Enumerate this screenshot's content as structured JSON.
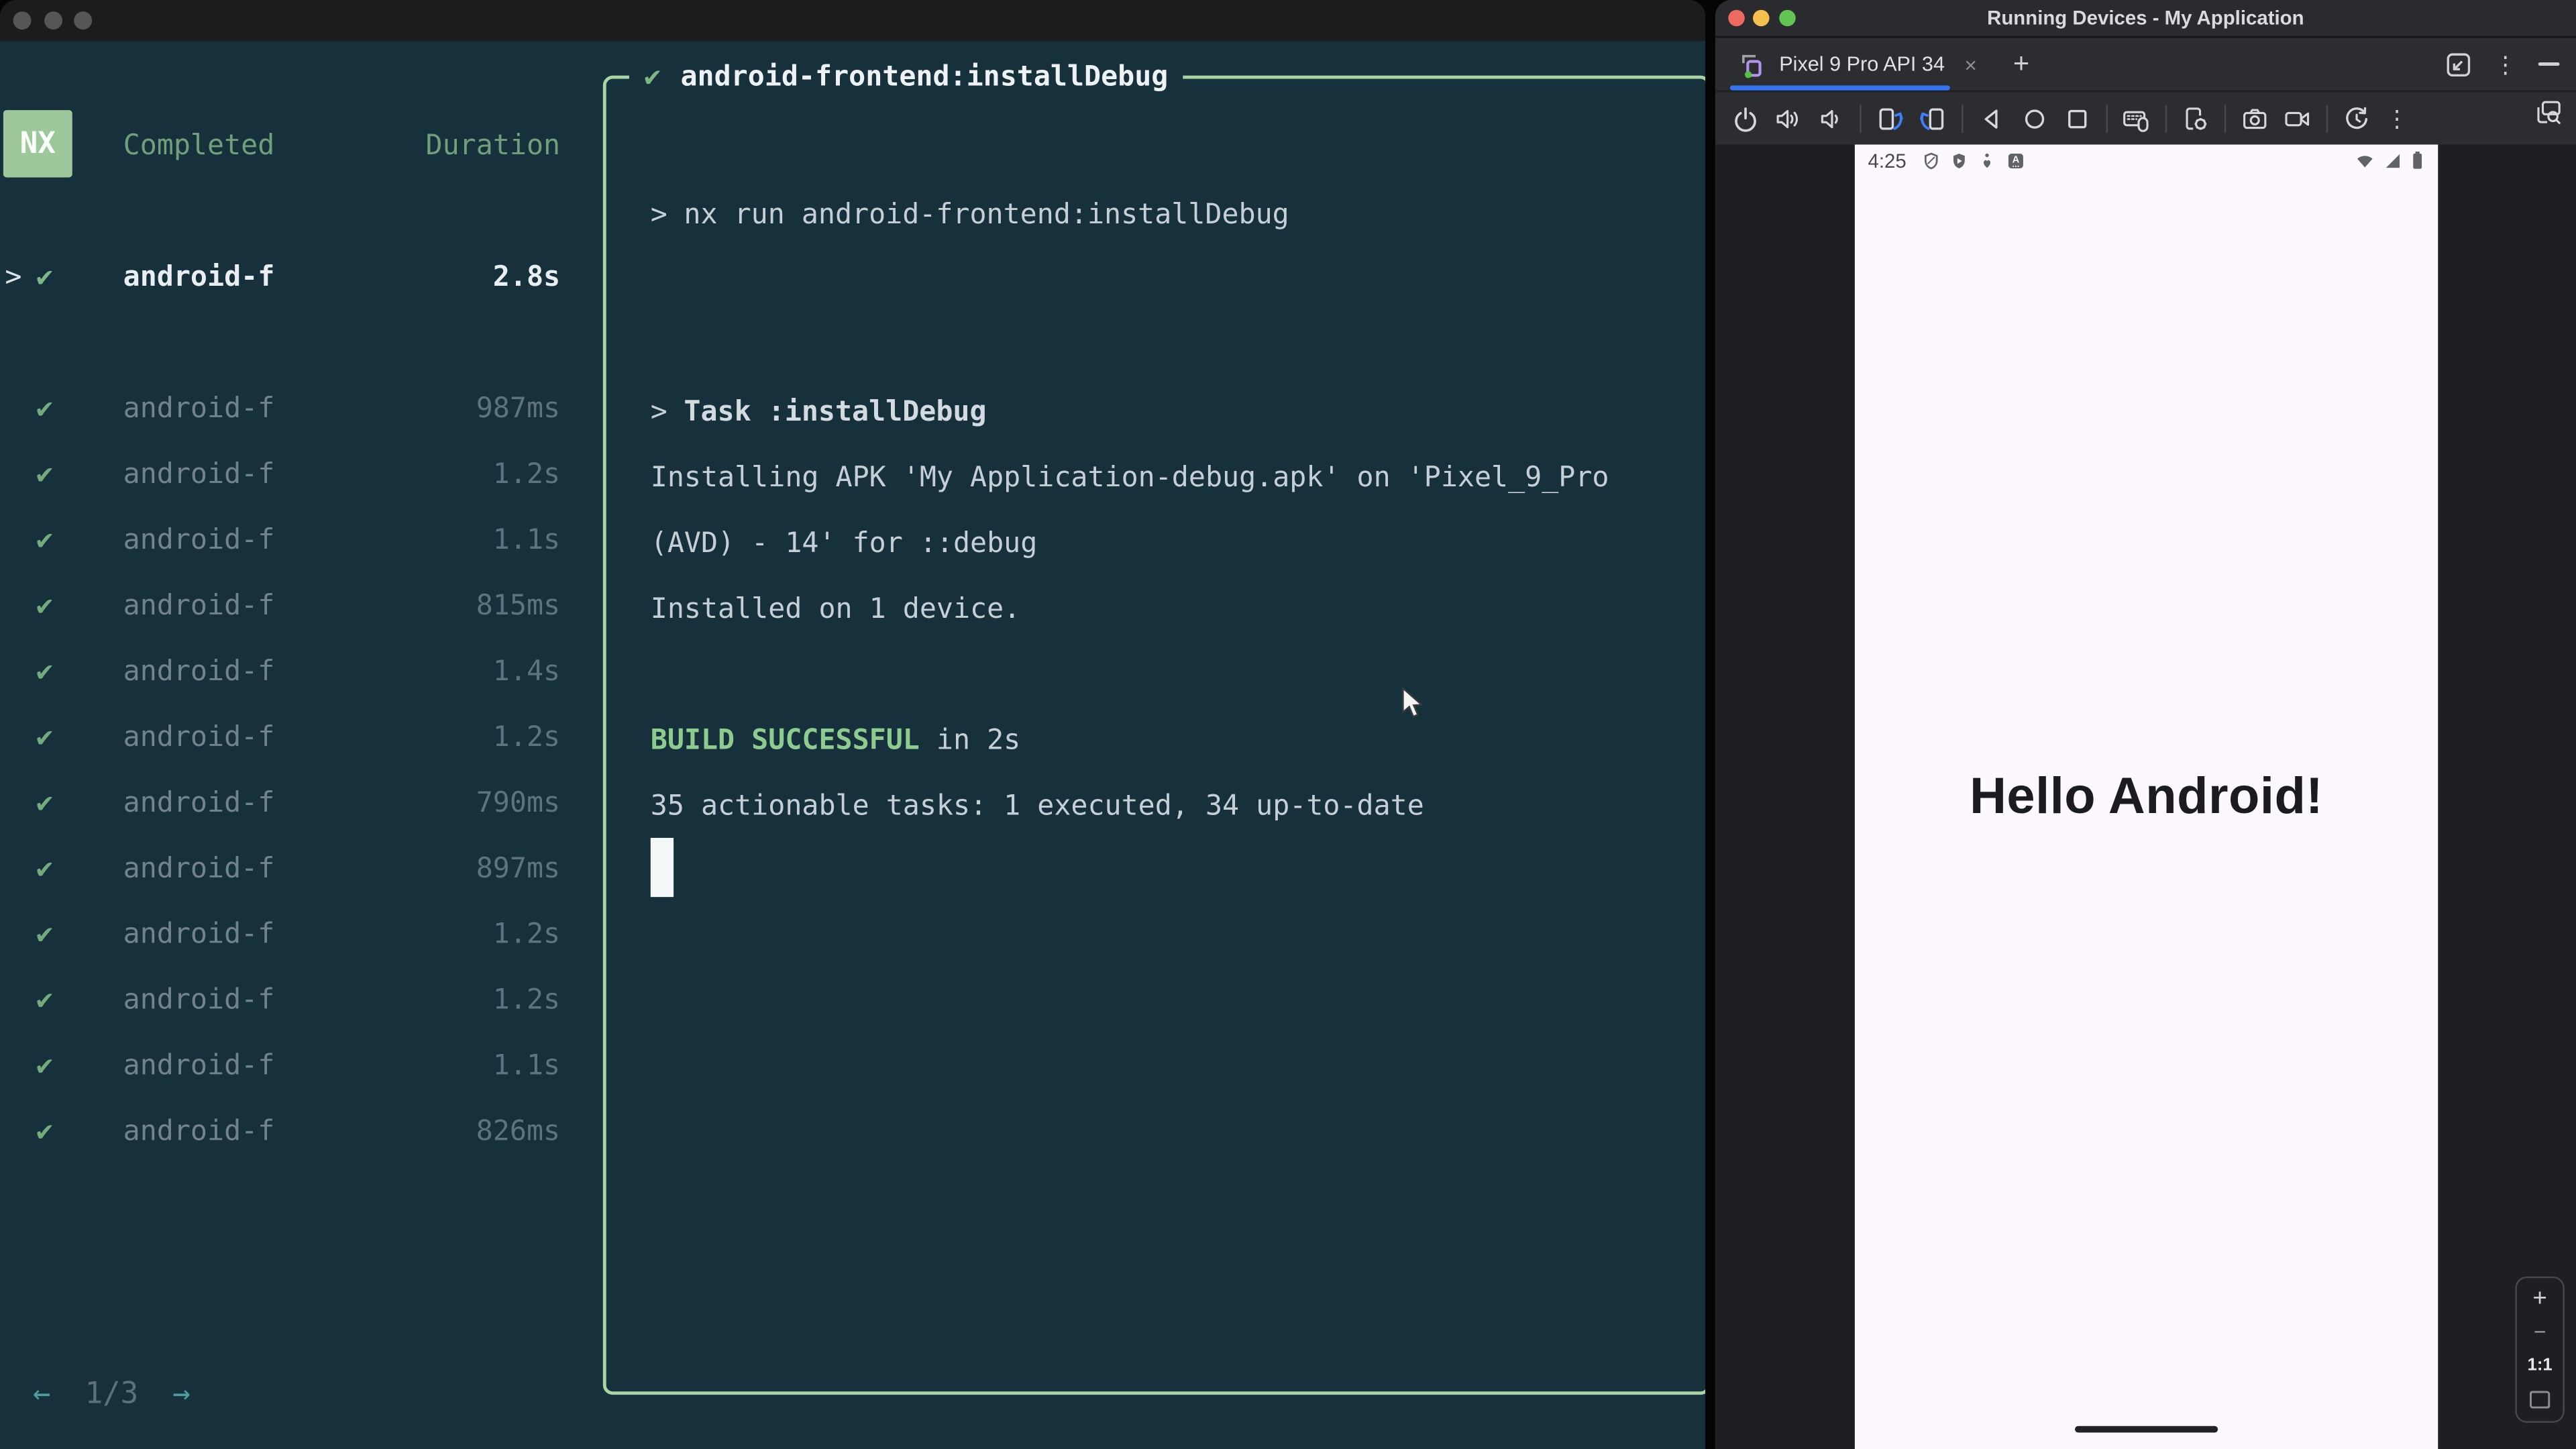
{
  "left_window": {
    "title_bar": {
      "controls": [
        "close",
        "minimize",
        "maximize"
      ]
    },
    "sidebar": {
      "logo": "NX",
      "header": {
        "completed": "Completed",
        "duration": "Duration"
      },
      "selected_task": {
        "prefix": ">",
        "check": "✔",
        "name": "android-f",
        "duration": "2.8s"
      },
      "tasks": [
        {
          "check": "✔",
          "name": "android-f",
          "duration": "987ms"
        },
        {
          "check": "✔",
          "name": "android-f",
          "duration": "1.2s"
        },
        {
          "check": "✔",
          "name": "android-f",
          "duration": "1.1s"
        },
        {
          "check": "✔",
          "name": "android-f",
          "duration": "815ms"
        },
        {
          "check": "✔",
          "name": "android-f",
          "duration": "1.4s"
        },
        {
          "check": "✔",
          "name": "android-f",
          "duration": "1.2s"
        },
        {
          "check": "✔",
          "name": "android-f",
          "duration": "790ms"
        },
        {
          "check": "✔",
          "name": "android-f",
          "duration": "897ms"
        },
        {
          "check": "✔",
          "name": "android-f",
          "duration": "1.2s"
        },
        {
          "check": "✔",
          "name": "android-f",
          "duration": "1.2s"
        },
        {
          "check": "✔",
          "name": "android-f",
          "duration": "1.1s"
        },
        {
          "check": "✔",
          "name": "android-f",
          "duration": "826ms"
        }
      ],
      "pagination": {
        "prev": "←",
        "page": "1/3",
        "next": "→"
      }
    },
    "terminal_box": {
      "check": "✔",
      "title": "android-frontend:installDebug",
      "prompt": ">",
      "command": "nx run android-frontend:installDebug",
      "task_line": "Task :installDebug",
      "install_line_1": "Installing APK 'My Application-debug.apk' on 'Pixel_9_Pro",
      "install_line_2": "(AVD) - 14' for ::debug",
      "install_line_3": "Installed on 1 device.",
      "build_status": "BUILD SUCCESSFUL",
      "build_suffix": " in 2s",
      "summary": "35 actionable tasks: 1 executed, 34 up-to-date"
    }
  },
  "right_window": {
    "title": "Running Devices - My Application",
    "tab_bar": {
      "active_tab": "Pixel 9 Pro API 34",
      "close": "×",
      "new_tab": "+",
      "more_glyph": "⋮",
      "window_controls": [
        "restore-down",
        "more",
        "hide"
      ]
    },
    "toolbar": {
      "more_glyph": "⋮",
      "icons": [
        "power",
        "volume-up",
        "volume-down",
        "rotate-left",
        "rotate-right",
        "back",
        "home",
        "overview",
        "keyboard-mouse",
        "device-settings",
        "screenshot",
        "screen-record",
        "reset",
        "more",
        "snapshots-search"
      ]
    },
    "device_screen": {
      "status_time": "4:25",
      "status_icons_left": [
        "vpn-shield",
        "play-protect",
        "wellbeing",
        "autofill"
      ],
      "status_icons_right": [
        "wifi",
        "cellular-signal",
        "battery"
      ],
      "message": "Hello Android!"
    },
    "zoom_controls": {
      "zoom_in": "+",
      "zoom_out": "−",
      "ratio": "1:1",
      "fit": "fit-screen"
    }
  },
  "colors": {
    "terminal_bg": "#16313c",
    "accent_green": "#a7d5a3",
    "badge_green": "#9cc89c",
    "success_green": "#8ecb8f",
    "tab_accent": "#3574f0"
  }
}
